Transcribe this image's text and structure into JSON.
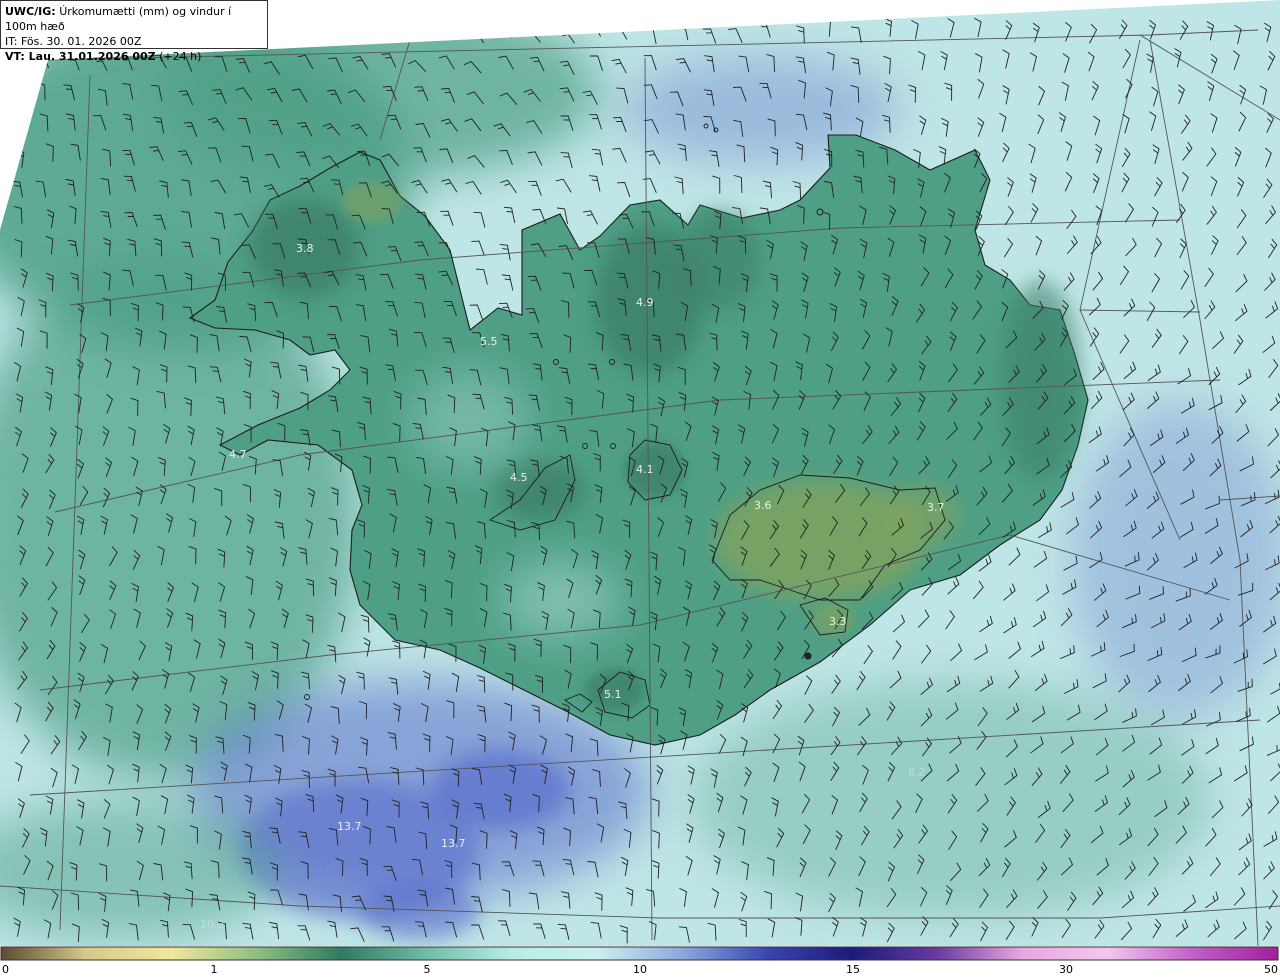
{
  "header": {
    "model": "UWC/IG:",
    "description": "Úrkomumætti (mm) og vindur í 100m hæð",
    "initial_time": "IT: Fös. 30. 01. 2026 00Z",
    "valid_label": "VT: Lau. 31.01.2026 00Z",
    "valid_offset": "(+24 h)"
  },
  "colors": {
    "ocean": "#bfe6e6",
    "ocean_deep": "#a8d4dc",
    "land": "#4e9f86",
    "highland": "#3c7f6a",
    "glacier_field": "#7fa35e",
    "precip_blue": "#5a6dcc",
    "outline": "#1c1c1c",
    "barb": "#222222"
  },
  "value_labels": [
    {
      "text": "3.8"
    },
    {
      "text": "5.5"
    },
    {
      "text": "4.9"
    },
    {
      "text": "4.7"
    },
    {
      "text": "4.5"
    },
    {
      "text": "4.1"
    },
    {
      "text": "3.6"
    },
    {
      "text": "3.7"
    },
    {
      "text": "3.3"
    },
    {
      "text": "5.1"
    },
    {
      "text": "13.7"
    },
    {
      "text": "13.7"
    },
    {
      "text": "8.2"
    },
    {
      "text": "10.2"
    }
  ],
  "colorbar": {
    "ticks": [
      "0",
      "1",
      "5",
      "10",
      "15",
      "30",
      "50"
    ],
    "stops": [
      "#5b4a30",
      "#d6c98a",
      "#f0e79a",
      "#8fbf80",
      "#2f7a62",
      "#6fbca8",
      "#b8ece6",
      "#c8f0ee",
      "#8ea8dc",
      "#3846b0",
      "#1b1b7a",
      "#6a3aa0",
      "#e8a8e0",
      "#f4c6ee",
      "#c060c8",
      "#a0209a"
    ]
  }
}
